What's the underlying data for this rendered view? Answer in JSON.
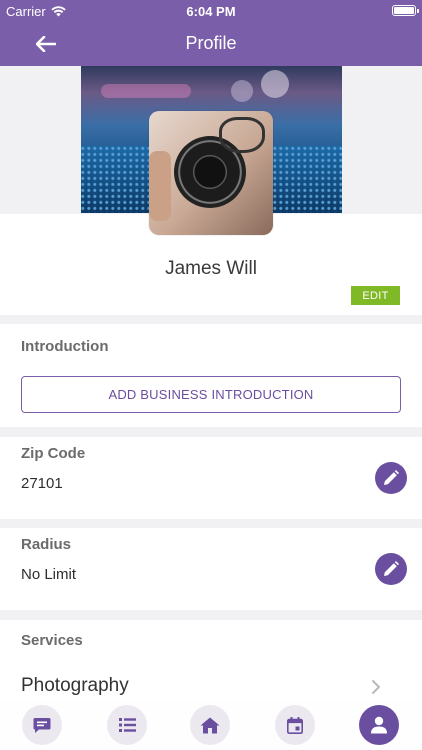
{
  "status_bar": {
    "carrier": "Carrier",
    "time": "6:04 PM"
  },
  "nav": {
    "title": "Profile",
    "back_icon": "arrow-left-icon"
  },
  "profile": {
    "name": "James Will",
    "edit_label": "EDIT"
  },
  "introduction": {
    "label": "Introduction",
    "button_label": "ADD BUSINESS INTRODUCTION"
  },
  "zip": {
    "label": "Zip Code",
    "value": "27101"
  },
  "radius": {
    "label": "Radius",
    "value": "No Limit"
  },
  "services": {
    "label": "Services",
    "items": [
      "Photography"
    ]
  },
  "tabs": [
    {
      "name": "messages",
      "icon": "chat-icon",
      "active": false
    },
    {
      "name": "list",
      "icon": "list-icon",
      "active": false
    },
    {
      "name": "home",
      "icon": "home-icon",
      "active": false
    },
    {
      "name": "calendar",
      "icon": "calendar-icon",
      "active": false
    },
    {
      "name": "profile",
      "icon": "user-icon",
      "active": true
    }
  ],
  "colors": {
    "primary": "#7b5ea9",
    "accent_purple": "#6a4fa0",
    "edit_green": "#7fba26",
    "background": "#f1f1f3"
  }
}
